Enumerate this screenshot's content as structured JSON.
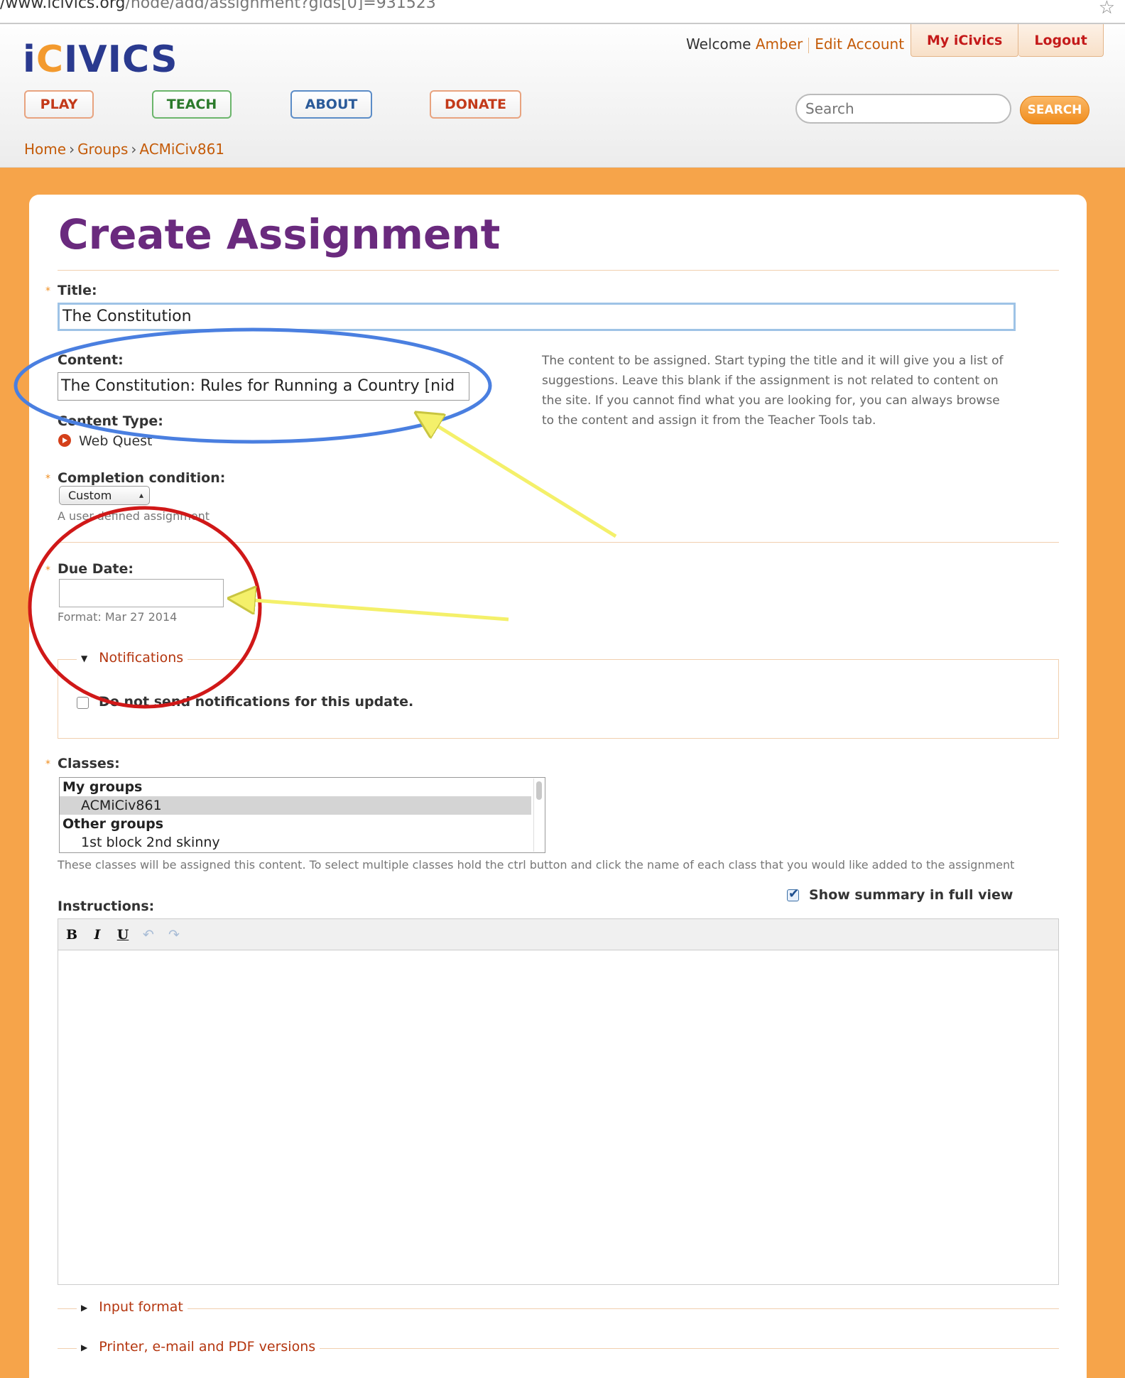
{
  "browser": {
    "url_prefix": "/www.icivics.org",
    "url_rest": "/node/add/assignment?gids[0]=931523"
  },
  "header": {
    "logo_i": "i",
    "logo_c": "C",
    "logo_rest": "IVICS",
    "welcome_prefix": "Welcome ",
    "user_name": "Amber",
    "edit_account": "Edit Account",
    "my_icivics": "My iCivics",
    "logout": "Logout",
    "nav": {
      "play": "PLAY",
      "teach": "TEACH",
      "about": "ABOUT",
      "donate": "DONATE"
    },
    "search_placeholder": "Search",
    "search_button": "SEARCH"
  },
  "breadcrumb": {
    "home": "Home",
    "groups": "Groups",
    "current": "ACMiCiv861",
    "separator": "›"
  },
  "form": {
    "page_title": "Create Assignment",
    "required_marker": "*",
    "title_label": "Title:",
    "title_value": "The Constitution",
    "content_label": "Content:",
    "content_value": "The Constitution: Rules for Running a Country [nid",
    "content_help": "The content to be assigned. Start typing the title and it will give you a list of suggestions. Leave this blank if the assignment is not related to content on the site. If you cannot find what you are looking for, you can always browse to the content and assign it from the Teacher Tools tab.",
    "content_type_label": "Content Type:",
    "content_type_value": "Web Quest",
    "completion_label": "Completion condition:",
    "completion_value": "Custom",
    "completion_desc": "A user-defined assignment",
    "due_date_label": "Due Date:",
    "due_date_value": "",
    "due_date_format": "Format: Mar 27 2014",
    "notifications_legend": "Notifications",
    "notifications_checkbox": "Do not send notifications for this update.",
    "classes_label": "Classes:",
    "classes_options": [
      {
        "label": "My groups",
        "kind": "group"
      },
      {
        "label": "ACMiCiv861",
        "kind": "selected"
      },
      {
        "label": "Other groups",
        "kind": "group"
      },
      {
        "label": "1st block 2nd skinny",
        "kind": "child"
      }
    ],
    "classes_desc": "These classes will be assigned this content. To select multiple classes hold the ctrl button and click the name of each class that you would like added to the assignment",
    "instructions_label": "Instructions:",
    "show_summary": "Show summary in full view",
    "show_summary_checked": true,
    "editor_buttons": {
      "bold": "B",
      "italic": "I",
      "underline": "U",
      "undo": "↶",
      "redo": "↷"
    },
    "input_format": "Input format",
    "printer_versions": "Printer, e-mail and PDF versions"
  },
  "annotation_colors": {
    "blue_ellipse": "#4a7fe0",
    "red_circle": "#d01818",
    "yellow_arrow": "#f4f06a"
  }
}
